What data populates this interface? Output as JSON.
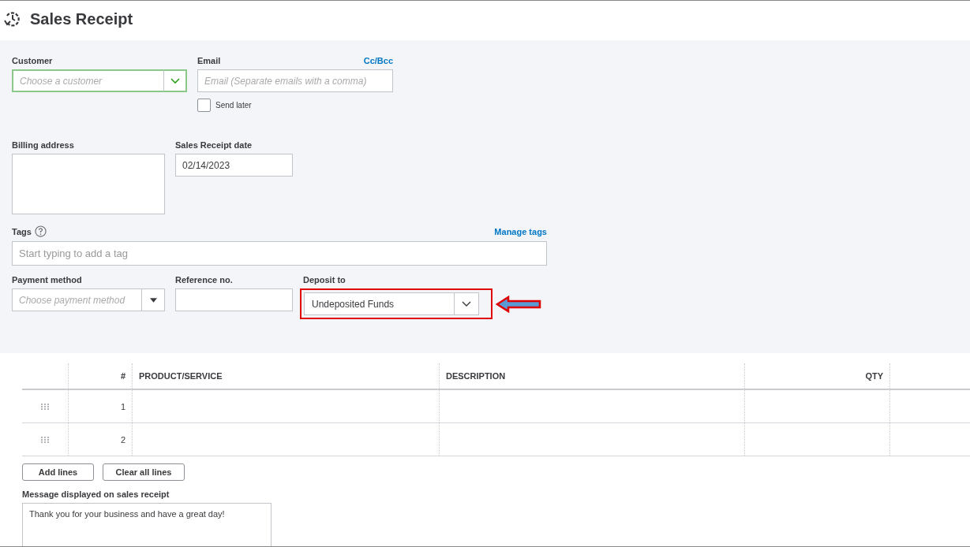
{
  "header": {
    "title": "Sales Receipt"
  },
  "form": {
    "customer": {
      "label": "Customer",
      "placeholder": "Choose a customer",
      "focused": true
    },
    "email": {
      "label": "Email",
      "link": "Cc/Bcc",
      "placeholder": "Email (Separate emails with a comma)"
    },
    "send_later": {
      "label": "Send later",
      "checked": false
    },
    "billing_address": {
      "label": "Billing address"
    },
    "date": {
      "label": "Sales Receipt date",
      "value": "02/14/2023"
    },
    "tags": {
      "label": "Tags",
      "link": "Manage tags",
      "placeholder": "Start typing to add a tag"
    },
    "payment_method": {
      "label": "Payment method",
      "placeholder": "Choose payment method"
    },
    "reference": {
      "label": "Reference no."
    },
    "deposit_to": {
      "label": "Deposit to",
      "value": "Undeposited Funds",
      "highlighted": true
    }
  },
  "table": {
    "columns": [
      "#",
      "PRODUCT/SERVICE",
      "DESCRIPTION",
      "QTY"
    ],
    "rows": [
      {
        "number": "1"
      },
      {
        "number": "2"
      }
    ]
  },
  "buttons": [
    "Add lines",
    "Clear all lines"
  ],
  "message": {
    "label": "Message displayed on sales receipt",
    "value": "Thank you for your business and have a great day!"
  }
}
